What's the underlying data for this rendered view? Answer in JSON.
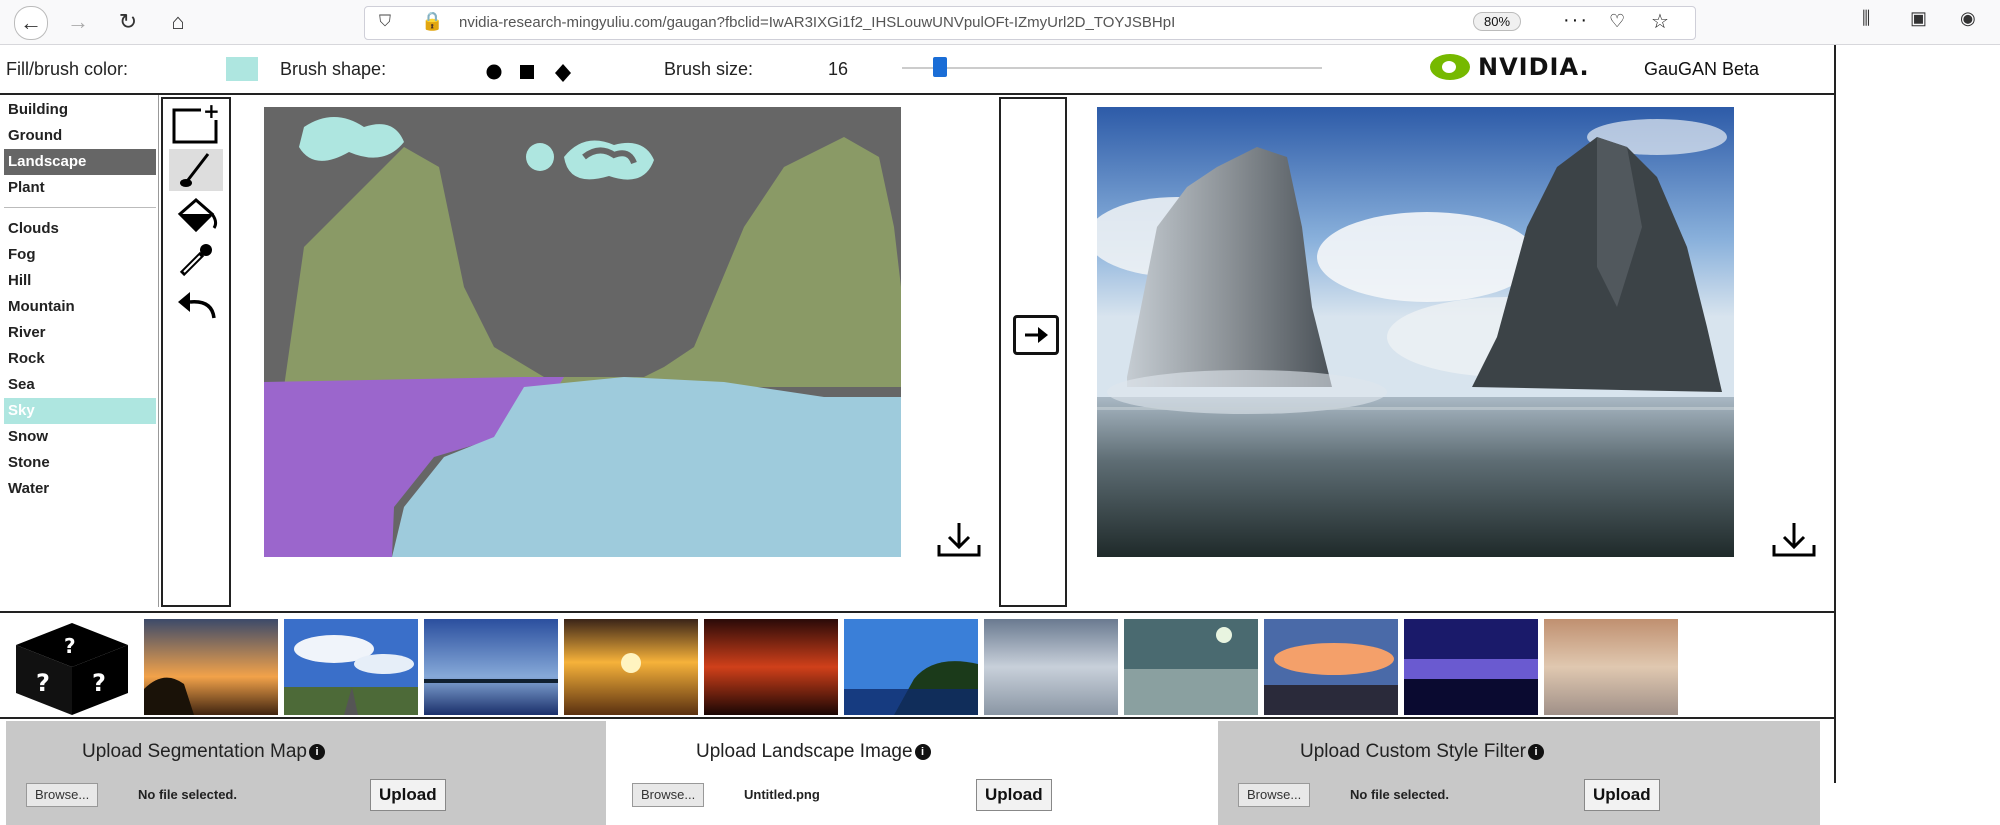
{
  "browser": {
    "url": "nvidia-research-mingyuliu.com/gaugan?fbclid=IwAR3IXGi1f2_IHSLouwUNVpulOFt-IZmyUrl2D_TOYJSBHpI",
    "zoom": "80%",
    "more": "···"
  },
  "toolbar": {
    "fill_label": "Fill/brush color:",
    "fill_color": "#aee6e0",
    "shape_label": "Brush shape:",
    "size_label": "Brush size:",
    "size_value": "16",
    "brand": "NVIDIA.",
    "app_name": "GauGAN Beta"
  },
  "labels": {
    "group1": [
      "Building",
      "Ground",
      "Landscape",
      "Plant"
    ],
    "group2": [
      "Clouds",
      "Fog",
      "Hill",
      "Mountain",
      "River",
      "Rock",
      "Sea",
      "Sky",
      "Snow",
      "Stone",
      "Water"
    ],
    "selected_category": "Landscape",
    "selected_label": "Sky"
  },
  "tools": [
    "new-canvas-icon",
    "brush-icon",
    "paint-bucket-icon",
    "eyedropper-icon",
    "undo-icon"
  ],
  "upload": {
    "seg_title": "Upload Segmentation Map",
    "land_title": "Upload Landscape Image",
    "style_title": "Upload Custom Style Filter",
    "browse": "Browse...",
    "seg_file": "No file selected.",
    "land_file": "Untitled.png",
    "style_file": "No file selected.",
    "upload_btn": "Upload",
    "info": "i"
  },
  "colors": {
    "sky_seg": "#aee6e0",
    "mountain_seg": "#8a9a66",
    "water_seg": "#9ecbdc",
    "river_seg": "#9b66cc",
    "brand_green": "#76b900"
  }
}
